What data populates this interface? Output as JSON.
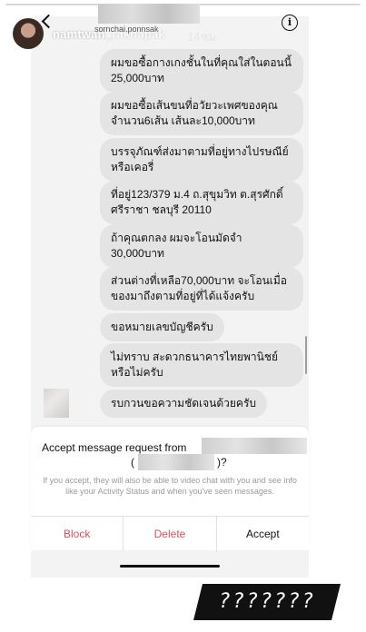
{
  "header": {
    "username": "namtwan_",
    "username_suffix": "raknapak",
    "time": "14ชม.",
    "sender_sub": "sornchai.ponnsak"
  },
  "messages": [
    "ผมขอซื้อกางเกงชั้นในที่คุณใส่ในตอนนี้ 25,000บาท",
    "ผมขอซื้อเส้นขนที่อวัยวะเพศของคุณ จำนวน6เส้น เส้นละ10,000บาท",
    "บรรจุภัณฑ์ส่งมาตามที่อยู่ทางไปรษณีย์ หรือเคอรี่",
    "ที่อยู่123/379 ม.4 ถ.สุขุมวิท ต.สุรศักดิ์ ศรีราชา ชลบุรี 20110",
    "ถ้าคุณตกลง ผมจะโอนมัดจำ 30,000บาท",
    "ส่วนต่างที่เหลือ70,000บาท จะโอนเมื่อ ของมาถึงตามที่อยู่ที่ได้แจ้งครับ",
    "ขอหมายเลขบัญชีครับ",
    "ไม่ทราบ สะดวกธนาคารไทยพานิชย์ หรือไม่ครับ",
    "รบกวนขอความชัดเจนด้วยครับ"
  ],
  "sheet": {
    "title": "Accept message request from",
    "paren_open": "(",
    "paren_close": ")?",
    "description": "If you accept, they will also be able to video chat with you and see info like your Activity Status and when you've seen messages.",
    "block": "Block",
    "delete": "Delete",
    "accept": "Accept"
  },
  "sticker": {
    "text": "???????"
  },
  "colors": {
    "destructive": "#d6525a",
    "bubble": "#e4e4e4",
    "panel": "#f3f3f3"
  }
}
